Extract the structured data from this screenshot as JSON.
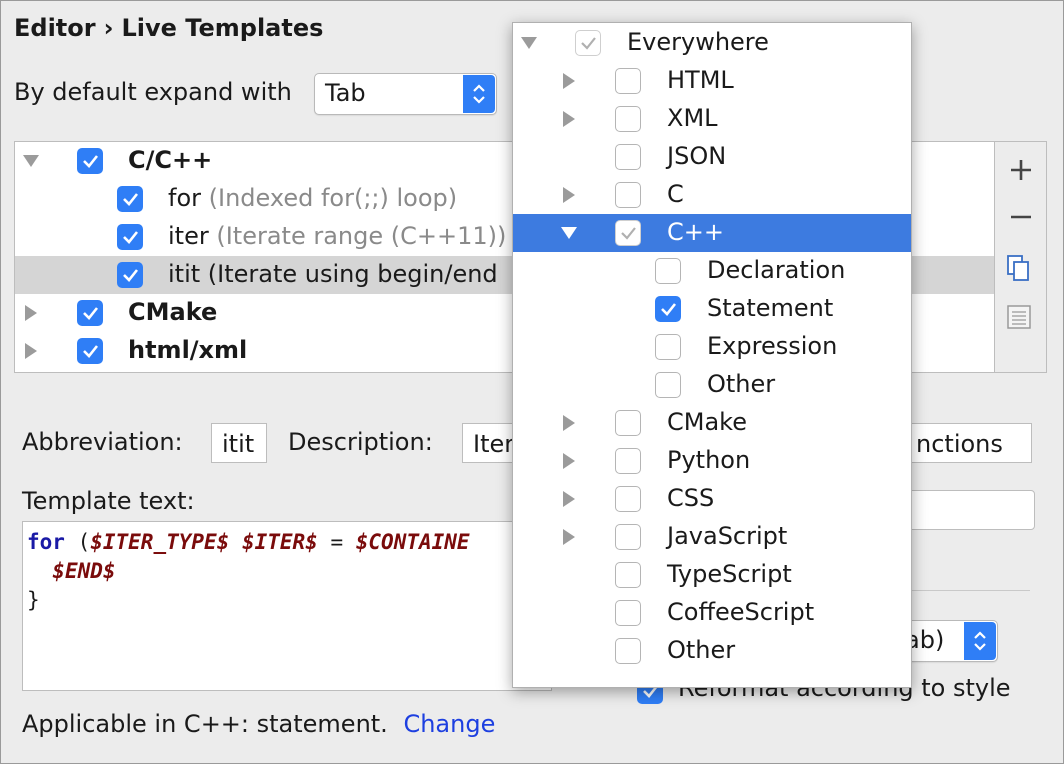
{
  "header": {
    "breadcrumb_parent": "Editor",
    "breadcrumb_separator": "›",
    "breadcrumb_current": "Live Templates"
  },
  "expand": {
    "label": "By default expand with",
    "value": "Tab"
  },
  "templates": [
    {
      "name": "C/C++",
      "checked": true,
      "expanded": true,
      "bold": true
    },
    {
      "name": "for",
      "desc": "(Indexed for(;;) loop)",
      "checked": true
    },
    {
      "name": "iter",
      "desc": "(Iterate range (C++11))",
      "checked": true
    },
    {
      "name": "itit",
      "desc": "(Iterate using begin/end",
      "checked": true,
      "selected": true
    },
    {
      "name": "CMake",
      "checked": true,
      "bold": true
    },
    {
      "name": "html/xml",
      "checked": true,
      "bold": true
    }
  ],
  "toolbar": {
    "add_icon": "plus-icon",
    "remove_icon": "minus-icon",
    "copy_icon": "copy-icon",
    "group_icon": "list-icon"
  },
  "fields": {
    "abbreviation_label": "Abbreviation:",
    "abbreviation_value": "itit",
    "description_label": "Description:",
    "description_value_left": "Iter",
    "description_value_right": "nctions",
    "template_text_label": "Template text:"
  },
  "code": {
    "line1_kw": "for",
    "line1_open": " (",
    "line1_v1": "$ITER_TYPE$",
    "line1_sp": " ",
    "line1_v2": "$ITER$",
    "line1_eq": " = ",
    "line1_v3": "$CONTAINE",
    "line2_indent": "  ",
    "line2_v": "$END$",
    "line3": "}"
  },
  "options": {
    "expand_partial": "ab)",
    "reformat_label": "Reformat according to style"
  },
  "footer": {
    "applicable": "Applicable in C++: statement.",
    "change_link": "Change"
  },
  "context_popup": {
    "items": [
      {
        "label": "Everywhere",
        "level": 0,
        "arrow": "down",
        "check": "grey"
      },
      {
        "label": "HTML",
        "level": 1,
        "arrow": "right",
        "check": "off"
      },
      {
        "label": "XML",
        "level": 1,
        "arrow": "right",
        "check": "off"
      },
      {
        "label": "JSON",
        "level": 1,
        "arrow": "none",
        "check": "off"
      },
      {
        "label": "C",
        "level": 1,
        "arrow": "right",
        "check": "off"
      },
      {
        "label": "C++",
        "level": 1,
        "arrow": "down",
        "check": "grey",
        "highlighted": true
      },
      {
        "label": "Declaration",
        "level": 2,
        "arrow": "none",
        "check": "off"
      },
      {
        "label": "Statement",
        "level": 2,
        "arrow": "none",
        "check": "on"
      },
      {
        "label": "Expression",
        "level": 2,
        "arrow": "none",
        "check": "off"
      },
      {
        "label": "Other",
        "level": 2,
        "arrow": "none",
        "check": "off"
      },
      {
        "label": "CMake",
        "level": 1,
        "arrow": "right",
        "check": "off"
      },
      {
        "label": "Python",
        "level": 1,
        "arrow": "right",
        "check": "off"
      },
      {
        "label": "CSS",
        "level": 1,
        "arrow": "right",
        "check": "off"
      },
      {
        "label": "JavaScript",
        "level": 1,
        "arrow": "right",
        "check": "off"
      },
      {
        "label": "TypeScript",
        "level": 1,
        "arrow": "none",
        "check": "off"
      },
      {
        "label": "CoffeeScript",
        "level": 1,
        "arrow": "none",
        "check": "off"
      },
      {
        "label": "Other",
        "level": 1,
        "arrow": "none",
        "check": "off"
      }
    ]
  },
  "colors": {
    "accent": "#2f7ef6",
    "highlight": "#3d7be0",
    "link": "#1d3fe0",
    "keyword": "#1a1aa6",
    "variable": "#7a0b0b"
  }
}
